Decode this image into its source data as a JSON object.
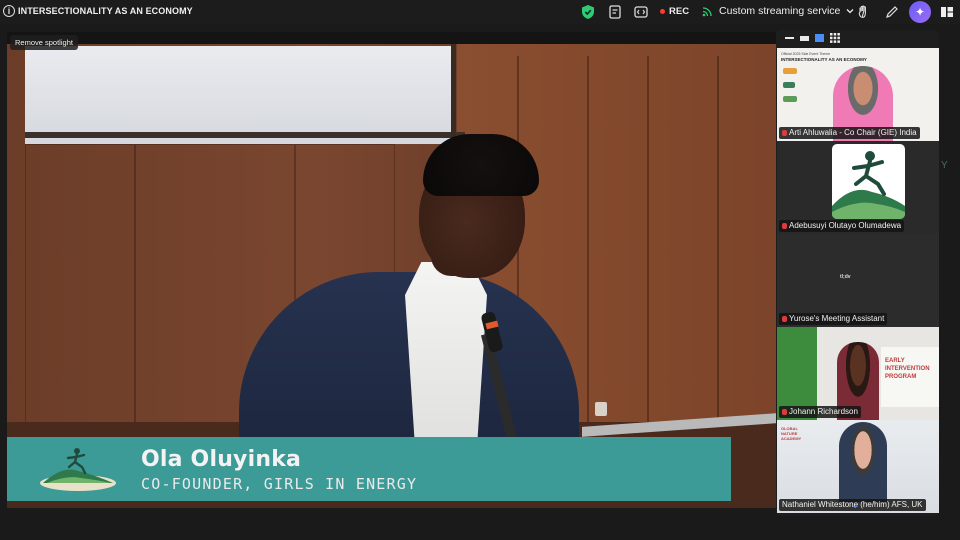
{
  "topbar": {
    "meeting_title": "INTERSECTIONALITY AS AN ECONOMY",
    "rec_label": "REC",
    "streaming_label": "Custom streaming service",
    "icons": [
      "info-icon",
      "shield-icon",
      "notes-icon",
      "captions-icon",
      "rec-dot-icon",
      "stream-icon",
      "chevron-down-icon",
      "hand-icon",
      "pen-icon",
      "ai-companion-icon",
      "layout-icon"
    ]
  },
  "main": {
    "spotlight_button": "Remove spotlight",
    "lower_third": {
      "name": "Ola Oluyinka",
      "role": "CO-FOUNDER, GIRLS IN ENERGY"
    }
  },
  "gallery": {
    "participants": [
      {
        "name": "Arti Ahluwalia - Co Chair (GIE) India",
        "muted": true
      },
      {
        "name": "Adebusuyi Olutayo Olumadewa",
        "muted": true
      },
      {
        "name": "Yurose's Meeting Assistant",
        "muted": true
      },
      {
        "name": "Johann Richardson",
        "muted": true
      },
      {
        "name": "Nathaniel Whitestone (he/him) AFS, UK",
        "muted": false
      }
    ],
    "tile1_text": "INTERSECTIONALITY AS AN ECONOMY",
    "tile1_subtext": "Official 2025 Side Event Theme",
    "tile3_text": "tl;dv",
    "tile4_text": "EARLY INTERVENTION PROGRAM",
    "tile5_text": "GLOBAL NATURE ACADEMY"
  },
  "colors": {
    "lower_third": "#3c9a97",
    "accent": "#4b8cf7",
    "rec": "#ff3b30",
    "mute": "#e03a3a"
  }
}
